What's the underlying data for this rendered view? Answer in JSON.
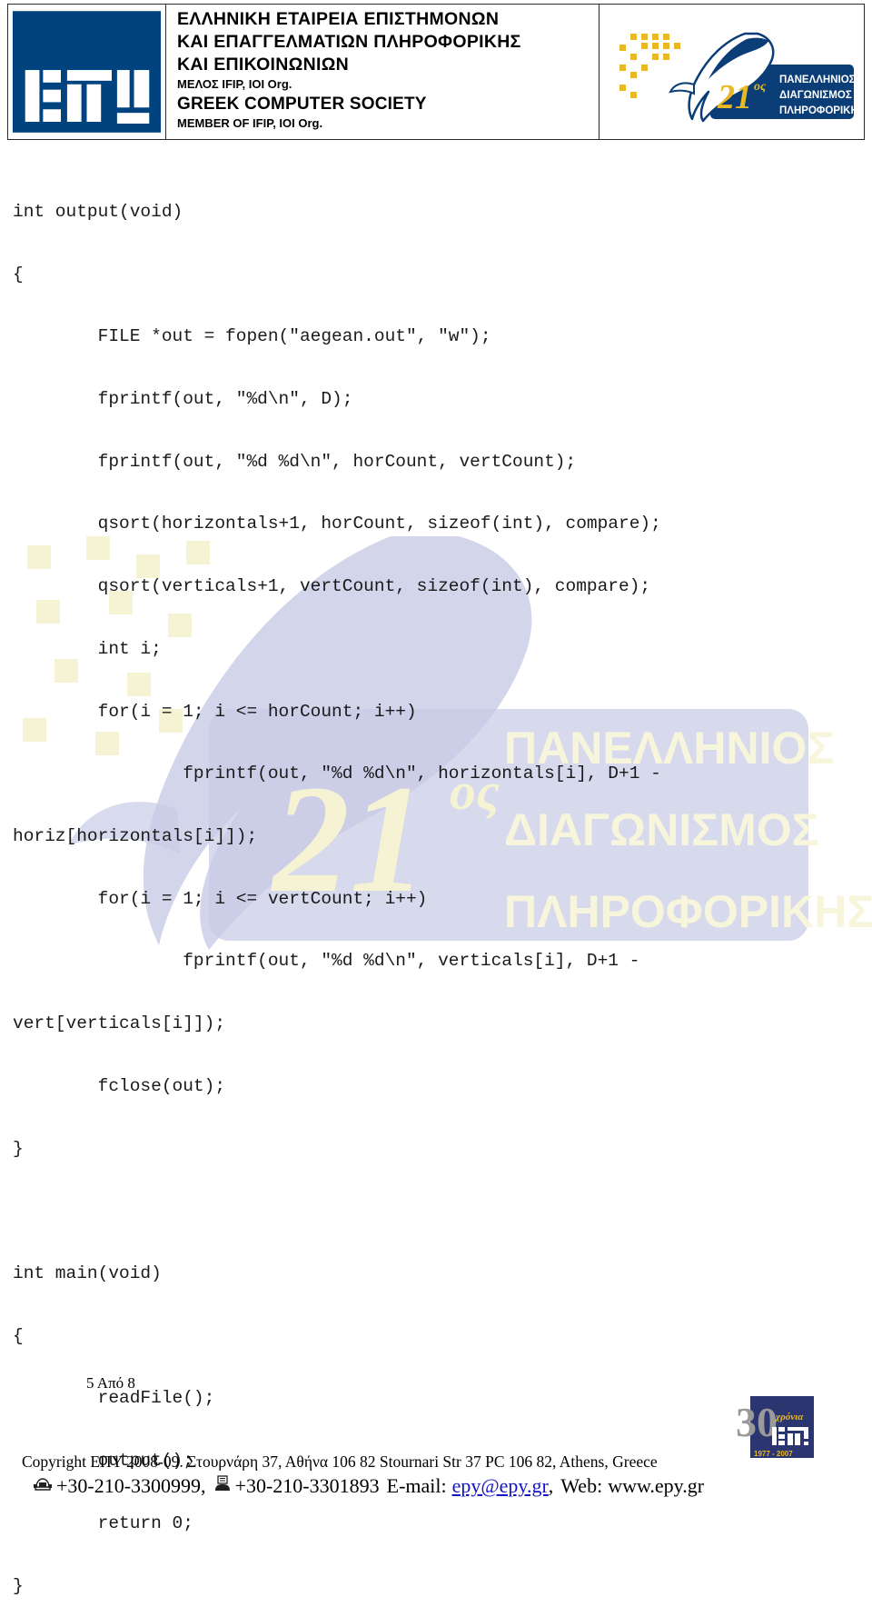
{
  "header": {
    "logo_icon": "epy-logo-icon",
    "org_lines": [
      "ΕΛΛΗΝΙΚΗ  ΕΤΑΙΡΕΙΑ  ΕΠΙΣΤΗΜΟΝΩΝ",
      "ΚΑΙ ΕΠΑΓΓΕΛΜΑΤΙΩΝ  ΠΛΗΡΟΦΟΡΙΚΗΣ",
      "ΚΑΙ ΕΠΙΚΟΙΝΩΝΙΩΝ"
    ],
    "member_greek": "ΜΕΛΟΣ IFIP, IOI Org.",
    "org_english": "GREEK COMPUTER SOCIETY",
    "member_english": "MEMBER OF IFIP, IOI Org.",
    "competition_logo": {
      "icon": "dolphin-logo-icon",
      "number": "21",
      "ordinal": "ος",
      "lines": [
        "ΠΑΝΕΛΛΗΝΙΟΣ",
        "ΔΙΑΓΩΝΙΣΜΟΣ",
        "ΠΛΗΡΟΦΟΡΙΚΗΣ"
      ]
    }
  },
  "code": {
    "language": "c",
    "lines": [
      "int output(void)",
      "{",
      "        FILE *out = fopen(\"aegean.out\", \"w\");",
      "        fprintf(out, \"%d\\n\", D);",
      "        fprintf(out, \"%d %d\\n\", horCount, vertCount);",
      "        qsort(horizontals+1, horCount, sizeof(int), compare);",
      "        qsort(verticals+1, vertCount, sizeof(int), compare);",
      "        int i;",
      "        for(i = 1; i <= horCount; i++)",
      "                fprintf(out, \"%d %d\\n\", horizontals[i], D+1 -",
      "horiz[horizontals[i]]);",
      "        for(i = 1; i <= vertCount; i++)",
      "                fprintf(out, \"%d %d\\n\", verticals[i], D+1 -",
      "vert[verticals[i]]);",
      "        fclose(out);",
      "}",
      "",
      "int main(void)",
      "{",
      "        readFile();",
      "        output();",
      "        return 0;",
      "}"
    ]
  },
  "watermark": {
    "number": "21",
    "ordinal": "ος",
    "lines": [
      "ΠΑΝΕΛΛΗΝΙΟΣ",
      "ΔΙΑΓΩΝΙΣΜΟΣ",
      "ΠΛΗΡΟΦΟΡΙΚΗΣ"
    ]
  },
  "page_number": "5 Από 8",
  "footer": {
    "copyright": "Copyright ΕΠΥ 2008-09. Στουρνάρη 37, Αθήνα 106 82 Stournari Str 37 PC 106 82, Athens, Greece",
    "phone_icon": "telephone-icon",
    "phone": "+30-210-3300999,",
    "fax_icon": "fax-icon",
    "fax": "+30-210-3301893",
    "email_label": "E-mail:",
    "email": "epy@epy.gr",
    "email_suffix": ",",
    "web_label": "Web:",
    "web": "www.epy.gr",
    "anniversary_logo": {
      "icon": "epy-30-years-icon",
      "number": "30",
      "word": "χρόνια",
      "years": "1977 - 2007"
    }
  },
  "colors": {
    "brand_blue": "#00437e",
    "logo_gold": "#e8b923",
    "link_blue": "#1414c8",
    "watermark_blue": "#c7cae4",
    "watermark_yellow": "#f7f3d6"
  }
}
